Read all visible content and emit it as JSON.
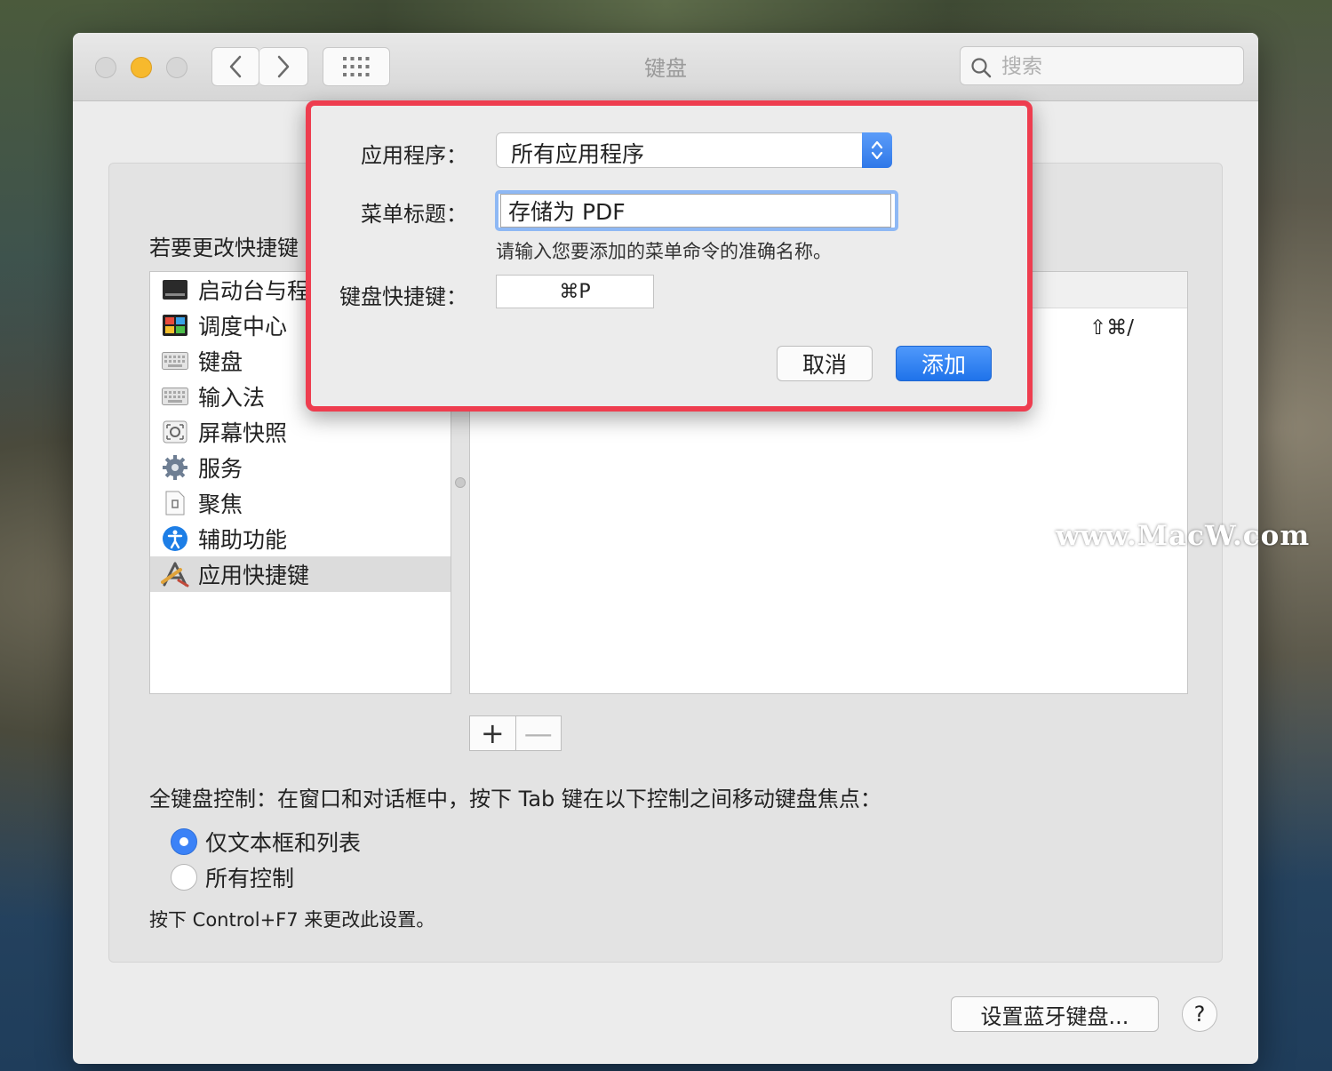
{
  "window": {
    "title": "键盘",
    "search_placeholder": "搜索"
  },
  "pane": {
    "instruction": "若要更改快捷键",
    "categories": [
      {
        "label": "启动台与程",
        "icon": "launchpad-icon"
      },
      {
        "label": "调度中心",
        "icon": "mission-control-icon"
      },
      {
        "label": "键盘",
        "icon": "keyboard-icon"
      },
      {
        "label": "输入法",
        "icon": "keyboard-icon"
      },
      {
        "label": "屏幕快照",
        "icon": "screenshot-icon"
      },
      {
        "label": "服务",
        "icon": "gear-icon"
      },
      {
        "label": "聚焦",
        "icon": "document-icon"
      },
      {
        "label": "辅助功能",
        "icon": "accessibility-icon"
      },
      {
        "label": "应用快捷键",
        "icon": "app-shortcuts-icon",
        "selected": true
      }
    ],
    "shortcut_row_value": "⇧⌘/",
    "add_label": "+",
    "remove_label": "—",
    "full_keyboard_label": "全键盘控制：在窗口和对话框中，按下 Tab 键在以下控制之间移动键盘焦点：",
    "radio_text_lists": "仅文本框和列表",
    "radio_all_controls": "所有控制",
    "hint": "按下 Control+F7 来更改此设置。",
    "bluetooth_button": "设置蓝牙键盘...",
    "help_button": "?"
  },
  "sheet": {
    "app_label": "应用程序：",
    "app_value": "所有应用程序",
    "menu_title_label": "菜单标题：",
    "menu_title_value": "存储为 PDF",
    "menu_help": "请输入您要添加的菜单命令的准确名称。",
    "shortcut_label": "键盘快捷键：",
    "shortcut_value": "⌘P",
    "cancel": "取消",
    "add": "添加",
    "highlight_color": "#ee3d4f"
  },
  "watermark": "www.MacW.com"
}
